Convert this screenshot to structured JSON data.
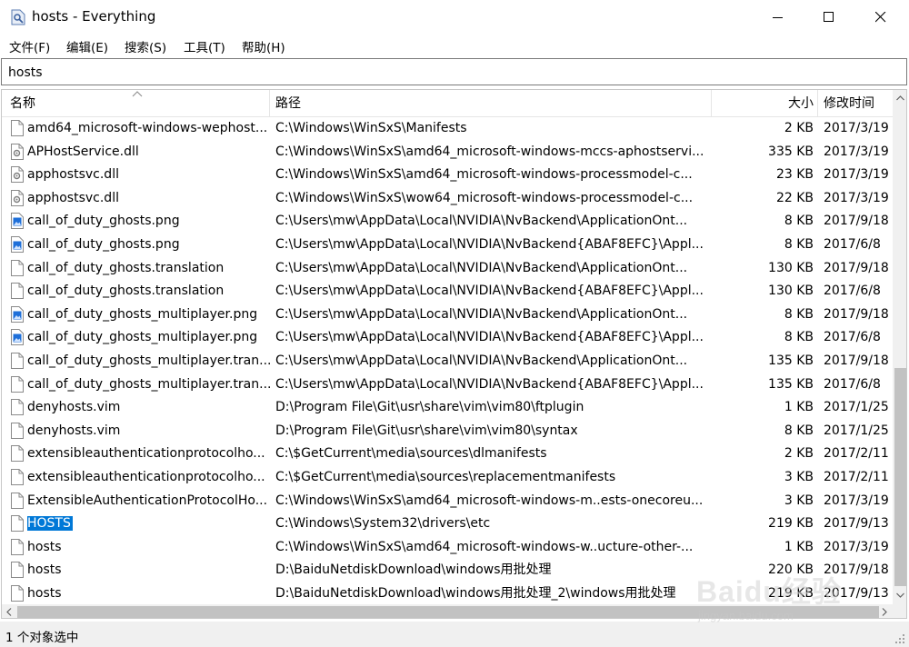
{
  "window": {
    "title": "hosts - Everything"
  },
  "menu": [
    "文件(F)",
    "编辑(E)",
    "搜索(S)",
    "工具(T)",
    "帮助(H)"
  ],
  "search": {
    "value": "hosts"
  },
  "columns": {
    "name": "名称",
    "path": "路径",
    "size": "大小",
    "modified": "修改时间"
  },
  "rows": [
    {
      "name": "amd64_microsoft-windows-wephost...",
      "path": "C:\\Windows\\WinSxS\\Manifests",
      "size": "2 KB",
      "date": "2017/3/19",
      "icon": "file-icon"
    },
    {
      "name": "APHostService.dll",
      "path": "C:\\Windows\\WinSxS\\amd64_microsoft-windows-mccs-aphostservi...",
      "size": "335 KB",
      "date": "2017/3/19",
      "icon": "dll-icon"
    },
    {
      "name": "apphostsvc.dll",
      "path": "C:\\Windows\\WinSxS\\amd64_microsoft-windows-processmodel-c...",
      "size": "23 KB",
      "date": "2017/3/19",
      "icon": "dll-icon"
    },
    {
      "name": "apphostsvc.dll",
      "path": "C:\\Windows\\WinSxS\\wow64_microsoft-windows-processmodel-c...",
      "size": "22 KB",
      "date": "2017/3/19",
      "icon": "dll-icon"
    },
    {
      "name": "call_of_duty_ghosts.png",
      "path": "C:\\Users\\mw\\AppData\\Local\\NVIDIA\\NvBackend\\ApplicationOnt...",
      "size": "8 KB",
      "date": "2017/9/18",
      "icon": "image-icon"
    },
    {
      "name": "call_of_duty_ghosts.png",
      "path": "C:\\Users\\mw\\AppData\\Local\\NVIDIA\\NvBackend{ABAF8EFC}\\Appl...",
      "size": "8 KB",
      "date": "2017/6/8",
      "icon": "image-icon"
    },
    {
      "name": "call_of_duty_ghosts.translation",
      "path": "C:\\Users\\mw\\AppData\\Local\\NVIDIA\\NvBackend\\ApplicationOnt...",
      "size": "130 KB",
      "date": "2017/9/18",
      "icon": "file-icon"
    },
    {
      "name": "call_of_duty_ghosts.translation",
      "path": "C:\\Users\\mw\\AppData\\Local\\NVIDIA\\NvBackend{ABAF8EFC}\\Appl...",
      "size": "130 KB",
      "date": "2017/6/8",
      "icon": "file-icon"
    },
    {
      "name": "call_of_duty_ghosts_multiplayer.png",
      "path": "C:\\Users\\mw\\AppData\\Local\\NVIDIA\\NvBackend\\ApplicationOnt...",
      "size": "8 KB",
      "date": "2017/9/18",
      "icon": "image-icon"
    },
    {
      "name": "call_of_duty_ghosts_multiplayer.png",
      "path": "C:\\Users\\mw\\AppData\\Local\\NVIDIA\\NvBackend{ABAF8EFC}\\Appl...",
      "size": "8 KB",
      "date": "2017/6/8",
      "icon": "image-icon"
    },
    {
      "name": "call_of_duty_ghosts_multiplayer.tran...",
      "path": "C:\\Users\\mw\\AppData\\Local\\NVIDIA\\NvBackend\\ApplicationOnt...",
      "size": "135 KB",
      "date": "2017/9/18",
      "icon": "file-icon"
    },
    {
      "name": "call_of_duty_ghosts_multiplayer.tran...",
      "path": "C:\\Users\\mw\\AppData\\Local\\NVIDIA\\NvBackend{ABAF8EFC}\\Appl...",
      "size": "135 KB",
      "date": "2017/6/8",
      "icon": "file-icon"
    },
    {
      "name": "denyhosts.vim",
      "path": "D:\\Program File\\Git\\usr\\share\\vim\\vim80\\ftplugin",
      "size": "1 KB",
      "date": "2017/1/25",
      "icon": "file-icon"
    },
    {
      "name": "denyhosts.vim",
      "path": "D:\\Program File\\Git\\usr\\share\\vim\\vim80\\syntax",
      "size": "8 KB",
      "date": "2017/1/25",
      "icon": "file-icon"
    },
    {
      "name": "extensibleauthenticationprotocolho...",
      "path": "C:\\$GetCurrent\\media\\sources\\dlmanifests",
      "size": "2 KB",
      "date": "2017/2/11",
      "icon": "file-icon"
    },
    {
      "name": "extensibleauthenticationprotocolho...",
      "path": "C:\\$GetCurrent\\media\\sources\\replacementmanifests",
      "size": "3 KB",
      "date": "2017/2/11",
      "icon": "file-icon"
    },
    {
      "name": "ExtensibleAuthenticationProtocolHo...",
      "path": "C:\\Windows\\WinSxS\\amd64_microsoft-windows-m..ests-onecoreu...",
      "size": "3 KB",
      "date": "2017/3/19",
      "icon": "file-icon"
    },
    {
      "name": "HOSTS",
      "path": "C:\\Windows\\System32\\drivers\\etc",
      "size": "219 KB",
      "date": "2017/9/13",
      "icon": "file-icon",
      "selected": true
    },
    {
      "name": "hosts",
      "path": "C:\\Windows\\WinSxS\\amd64_microsoft-windows-w..ucture-other-...",
      "size": "1 KB",
      "date": "2017/3/19",
      "icon": "file-icon"
    },
    {
      "name": "hosts",
      "path": "D:\\BaiduNetdiskDownload\\windows用批处理",
      "size": "220 KB",
      "date": "2017/9/18",
      "icon": "file-icon"
    },
    {
      "name": "hosts",
      "path": "D:\\BaiduNetdiskDownload\\windows用批处理_2\\windows用批处理",
      "size": "219 KB",
      "date": "2017/9/13",
      "icon": "file-icon"
    }
  ],
  "status": {
    "text": "1 个对象选中"
  },
  "watermark": {
    "brand": "Baidu经验",
    "url": "jingyan.baidu.com"
  },
  "colors": {
    "selection": "#0078d7",
    "image_icon_blue": "#1e6fd9"
  }
}
